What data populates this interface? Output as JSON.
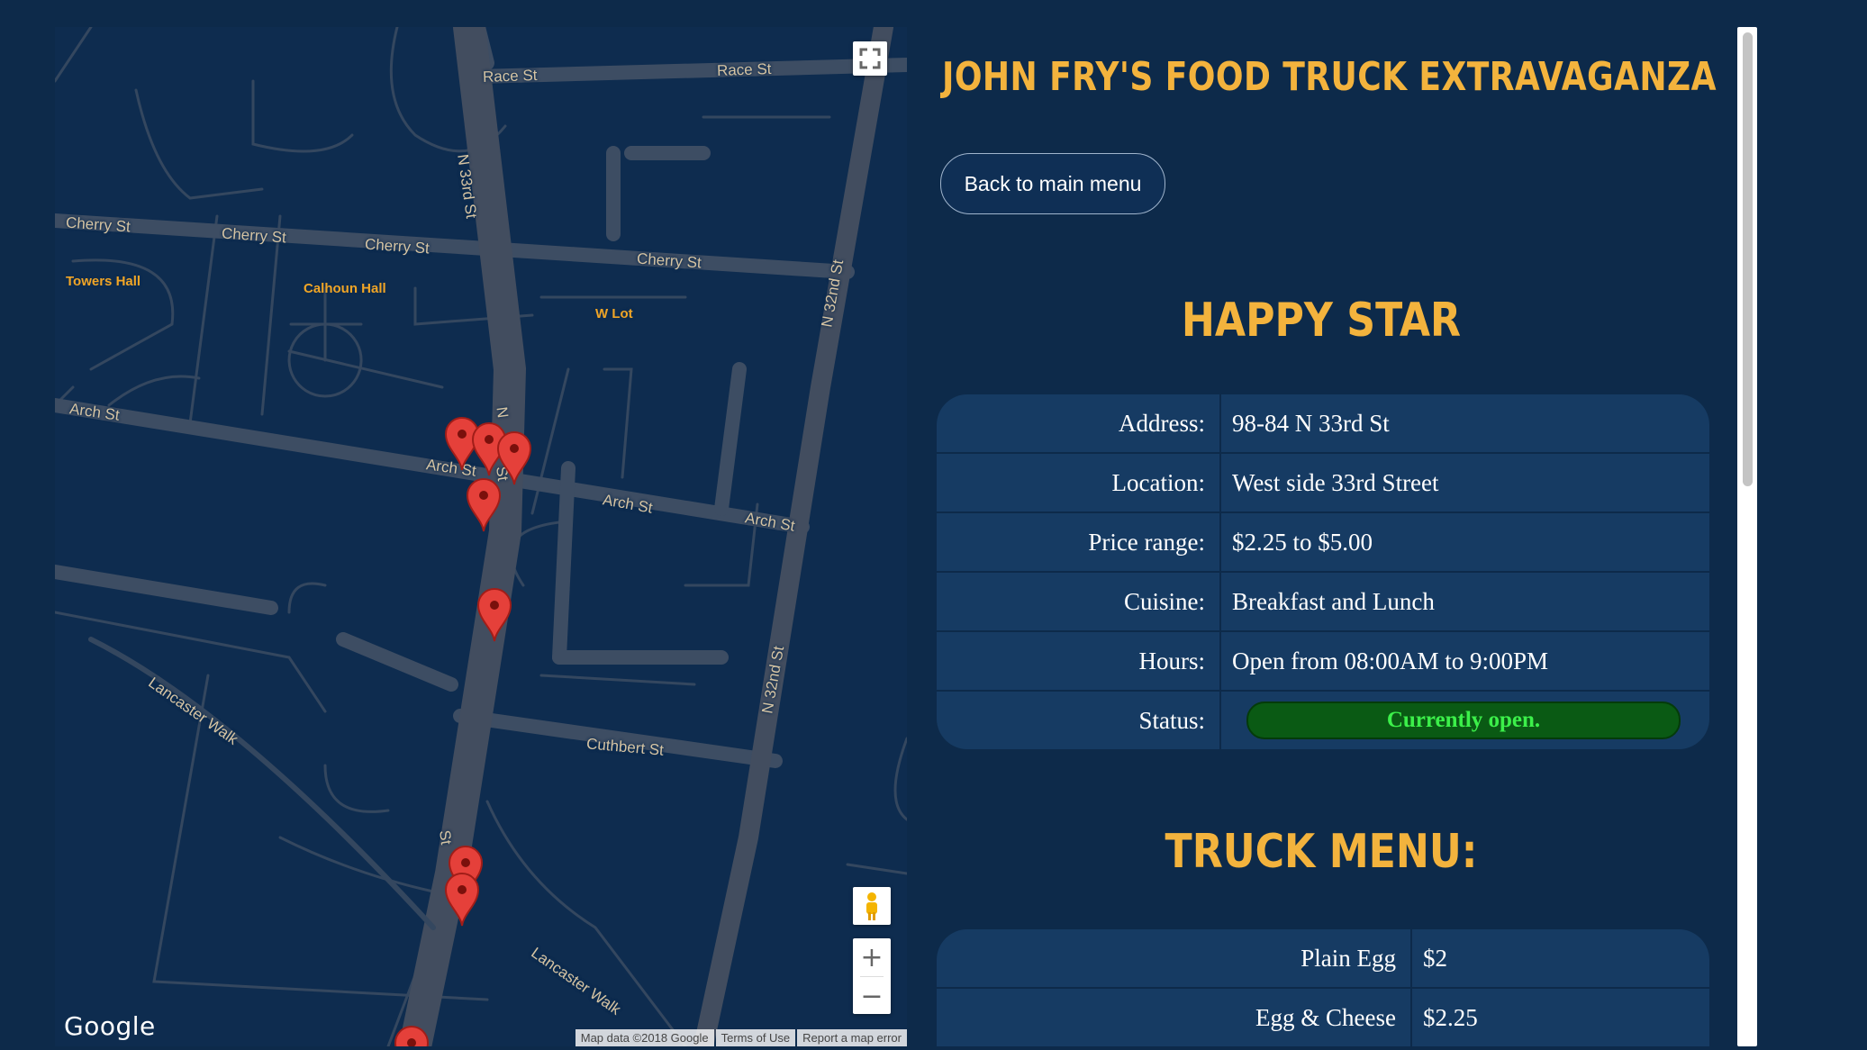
{
  "map": {
    "streets": {
      "race_1": "Race St",
      "race_2": "Race St",
      "cherry_1": "Cherry St",
      "cherry_2": "Cherry St",
      "cherry_3": "Cherry St",
      "cherry_4": "Cherry St",
      "arch_1": "Arch St",
      "arch_2": "Arch St",
      "arch_3": "Arch St",
      "arch_4": "Arch St",
      "n33rd": "N 33rd St",
      "n33rd_short_1": "N",
      "n33rd_short_2": "St",
      "n32nd_1": "N 32nd St",
      "n32nd_2": "N 32nd St",
      "cuthbert": "Cuthbert St",
      "lancaster_1": "Lancaster Walk",
      "lancaster_2": "Lancaster Walk"
    },
    "pois": {
      "towers": "Towers Hall",
      "calhoun": "Calhoun Hall",
      "wlot": "W Lot"
    },
    "marker_count": 8,
    "logo": "Google",
    "attribution": {
      "data": "Map data ©2018 Google",
      "terms": "Terms of Use",
      "report": "Report a map error"
    },
    "zoom_in": "+",
    "zoom_out": "−",
    "icons": [
      "fullscreen-icon",
      "pegman-icon",
      "map-pin-icon"
    ]
  },
  "header": {
    "title": "JOHN FRY'S FOOD TRUCK EXTRAVAGANZA",
    "back_label": "Back to main menu"
  },
  "truck": {
    "name": "HAPPY STAR",
    "details": [
      {
        "label": "Address:",
        "value": "98-84 N 33rd St"
      },
      {
        "label": "Location:",
        "value": "West side 33rd Street"
      },
      {
        "label": "Price range:",
        "value": "$2.25 to $5.00"
      },
      {
        "label": "Cuisine:",
        "value": "Breakfast and Lunch"
      },
      {
        "label": "Hours:",
        "value": "Open from 08:00AM to 9:00PM"
      },
      {
        "label": "Status:",
        "value": "Currently open."
      }
    ]
  },
  "menu": {
    "heading": "TRUCK MENU:",
    "items": [
      {
        "name": "Plain Egg",
        "price": "$2"
      },
      {
        "name": "Egg & Cheese",
        "price": "$2.25"
      }
    ]
  },
  "colors": {
    "background": "#0d2a4a",
    "accent": "#f3b33d",
    "status_open": "#3cf04a",
    "pin": "#e5403a"
  }
}
